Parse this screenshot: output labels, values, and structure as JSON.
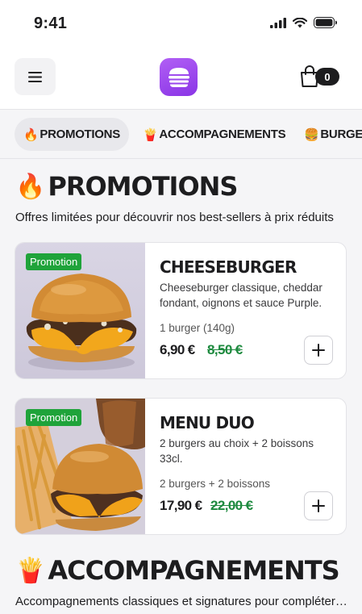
{
  "status": {
    "time": "9:41"
  },
  "header": {
    "cart_count": "0"
  },
  "tabs": [
    {
      "emoji": "🔥",
      "label": "PROMOTIONS"
    },
    {
      "emoji": "🍟",
      "label": "ACCOMPAGNEMENTS"
    },
    {
      "emoji": "🍔",
      "label": "BURGERS"
    }
  ],
  "sections": [
    {
      "emoji": "🔥",
      "title": "PROMOTIONS",
      "description": "Offres limitées pour découvrir nos best-sellers à prix réduits",
      "products": [
        {
          "badge": "Promotion",
          "title": "CHEESEBURGER",
          "description": "Cheeseburger classique, cheddar fondant, oignons et sauce Purple.",
          "quantity": "1 burger (140g)",
          "price": "6,90 €",
          "old_price": "8,50 €"
        },
        {
          "badge": "Promotion",
          "title": "MENU DUO",
          "description": "2 burgers au choix + 2 boissons 33cl.",
          "quantity": "2 burgers + 2 boissons",
          "price": "17,90 €",
          "old_price": "22,00 €"
        }
      ]
    },
    {
      "emoji": "🍟",
      "title": "ACCOMPAGNEMENTS",
      "description": "Accompagnements classiques et signatures pour compléter votre repas"
    }
  ],
  "colors": {
    "accent": "#9b45ee",
    "promo_green": "#1fa33a",
    "old_price_green": "#1e8a3f"
  }
}
